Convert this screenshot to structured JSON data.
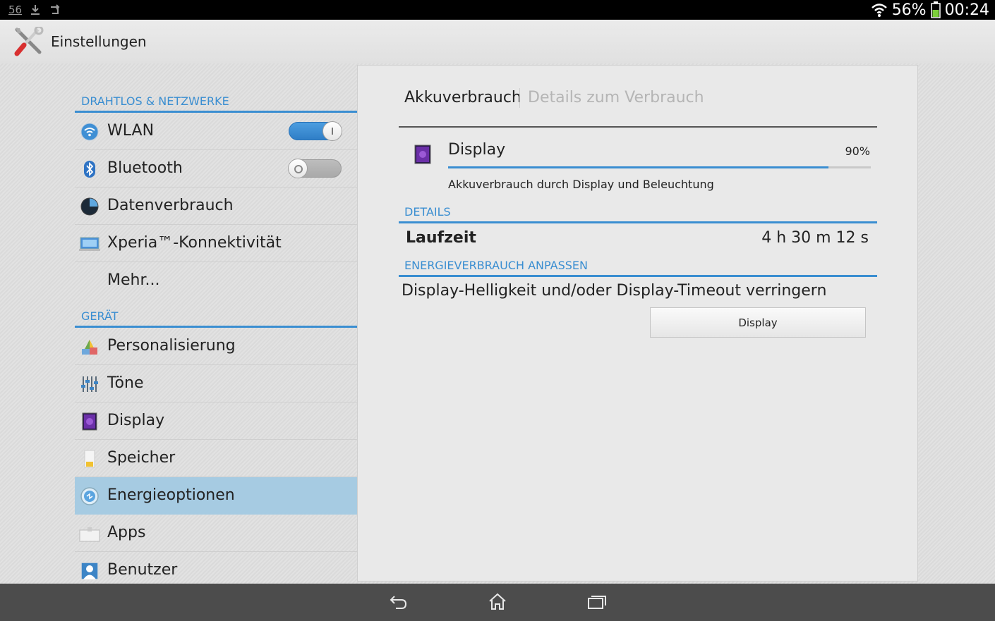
{
  "status_bar": {
    "notification_count": "56",
    "battery_percent": "56%",
    "time": "00:24",
    "icons": [
      "download-icon",
      "sync-icon",
      "wifi-icon",
      "battery-icon"
    ]
  },
  "action_bar": {
    "title": "Einstellungen",
    "icon": "settings-tools-icon"
  },
  "sidebar": {
    "sections": [
      {
        "header": "DRAHTLOS & NETZWERKE",
        "items": [
          {
            "label": "WLAN",
            "icon": "wifi-icon",
            "toggle": "on"
          },
          {
            "label": "Bluetooth",
            "icon": "bluetooth-icon",
            "toggle": "off"
          },
          {
            "label": "Datenverbrauch",
            "icon": "data-usage-icon"
          },
          {
            "label": "Xperia™-Konnektivität",
            "icon": "connectivity-icon"
          },
          {
            "label": "Mehr..."
          }
        ]
      },
      {
        "header": "GERÄT",
        "items": [
          {
            "label": "Personalisierung",
            "icon": "personalization-icon"
          },
          {
            "label": "Töne",
            "icon": "sound-icon"
          },
          {
            "label": "Display",
            "icon": "display-icon"
          },
          {
            "label": "Speicher",
            "icon": "storage-icon"
          },
          {
            "label": "Energieoptionen",
            "icon": "power-icon",
            "selected": true
          },
          {
            "label": "Apps",
            "icon": "apps-icon"
          },
          {
            "label": "Benutzer",
            "icon": "user-icon"
          }
        ]
      }
    ]
  },
  "detail": {
    "breadcrumb_active": "Akkuverbrauch",
    "breadcrumb_inactive": "Details zum Verbrauch",
    "usage": {
      "title": "Display",
      "percent": "90%",
      "fraction": 0.9,
      "description": "Akkuverbrauch durch Display und Beleuchtung",
      "icon": "display-icon"
    },
    "details_header": "DETAILS",
    "runtime_label": "Laufzeit",
    "runtime_value": "4 h 30 m 12 s",
    "adjust_header": "ENERGIEVERBRAUCH ANPASSEN",
    "tip_text": "Display-Helligkeit und/oder Display-Timeout verringern",
    "button_label": "Display"
  },
  "nav_bar": {
    "icons": [
      "back-icon",
      "home-icon",
      "recent-apps-icon"
    ]
  },
  "colors": {
    "accent": "#3a8ed1",
    "selected_bg": "#a6cbe2"
  }
}
